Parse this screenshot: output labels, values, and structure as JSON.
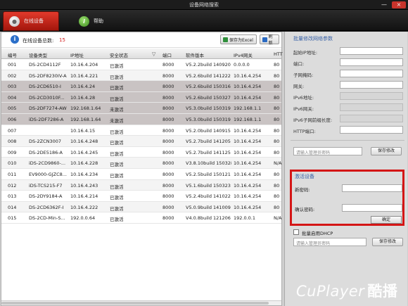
{
  "window": {
    "title": "设备网络搜索",
    "min_glyph": "—",
    "close_glyph": "×"
  },
  "tabs": [
    {
      "label": "在线设备",
      "icon": "user-icon",
      "active": true
    },
    {
      "label": "帮助",
      "icon": "help-icon",
      "glyph": "i"
    }
  ],
  "toolbar": {
    "online_label": "在线设备总数:",
    "online_count": "15",
    "export_label": "保存为Excel",
    "refresh_label": "刷新"
  },
  "table": {
    "headers": [
      "编号",
      "设备类型",
      "IP地址",
      "安全状态",
      "端口",
      "软件版本",
      "IPv4网关",
      "HTT"
    ],
    "filter_glyph": "▽",
    "rows": [
      [
        "001",
        "DS-2CD4112F",
        "10.16.4.204",
        "已激活",
        "8000",
        "V5.2.2build 140920",
        "0.0.0.0",
        "80"
      ],
      [
        "002",
        "DS-2DF8230IV-A",
        "10.16.4.221",
        "已激活",
        "8000",
        "V5.2.6build 141222",
        "10.16.4.254",
        "80"
      ],
      [
        "003",
        "DS-2CD6510-I",
        "10.16.4.24",
        "已激活",
        "8000",
        "V5.2.6build 150316",
        "10.16.4.254",
        "80"
      ],
      [
        "004",
        "DS-2CD3010F...",
        "10.16.4.28",
        "已激活",
        "8000",
        "V5.2.6build 150327",
        "10.16.4.254",
        "80"
      ],
      [
        "005",
        "DS-2DF7274-AW",
        "192.168.1.64",
        "未激活",
        "8000",
        "V5.3.0build 150319",
        "192.168.1.1",
        "80"
      ],
      [
        "006",
        "iDS-2DF7286-A",
        "192.168.1.64",
        "未激活",
        "8000",
        "V5.3.0build 150319",
        "192.168.1.1",
        "80"
      ],
      [
        "007",
        "",
        "10.16.4.15",
        "已激活",
        "8000",
        "V5.2.0build 140915",
        "10.16.4.254",
        "80"
      ],
      [
        "008",
        "DS-2ZCN3007",
        "10.16.4.248",
        "已激活",
        "8000",
        "V5.2.7build 141205",
        "10.16.4.254",
        "80"
      ],
      [
        "009",
        "DS-2DE5186-A",
        "10.16.4.245",
        "已激活",
        "8000",
        "V5.2.7build 141125",
        "10.16.4.254",
        "80"
      ],
      [
        "010",
        "iDS-2CD9860-...",
        "10.16.4.228",
        "已激活",
        "8000",
        "V3.8.10build 150328",
        "10.16.4.254",
        "N/A"
      ],
      [
        "011",
        "EV9000-GJZC8...",
        "10.16.4.234",
        "已激活",
        "8000",
        "V5.2.5build 150121",
        "10.16.4.254",
        "80"
      ],
      [
        "012",
        "iDS-TCS215-F7",
        "10.16.4.243",
        "已激活",
        "8000",
        "V5.1.6build 150323",
        "10.16.4.254",
        "80"
      ],
      [
        "013",
        "DS-2DY9184-A",
        "10.16.4.214",
        "已激活",
        "8000",
        "V5.2.4build 141022",
        "10.16.4.254",
        "80"
      ],
      [
        "014",
        "DS-2CD6362F-I",
        "10.16.4.222",
        "已激活",
        "8000",
        "V5.0.9build 141009",
        "10.16.4.254",
        "80"
      ],
      [
        "015",
        "DS-2CD-Min-S...",
        "192.0.0.64",
        "已激活",
        "8000",
        "V4.0.8build 121206",
        "192.0.0.1",
        "N/A"
      ]
    ]
  },
  "network_panel": {
    "title": "批量修改网络参数",
    "fields": [
      "起始IP地址:",
      "端口:",
      "子网掩码:",
      "网关:",
      "IPv6地址:",
      "IPv6网关:",
      "IPv6子网前缀长度:",
      "HTTP端口:"
    ],
    "password_placeholder": "请输入管理员密码",
    "save_label": "保存修改"
  },
  "activate_panel": {
    "title": "激活设备",
    "password_label": "新密码:",
    "confirm_label": "确认密码:",
    "confirm_button": "确定"
  },
  "dhcp": {
    "label": "批量启用DHCP",
    "password_placeholder": "请输入管理员密码",
    "save_label": "保存修改"
  },
  "watermark": {
    "latin": "CuPlayer",
    "cn": "酷播"
  }
}
